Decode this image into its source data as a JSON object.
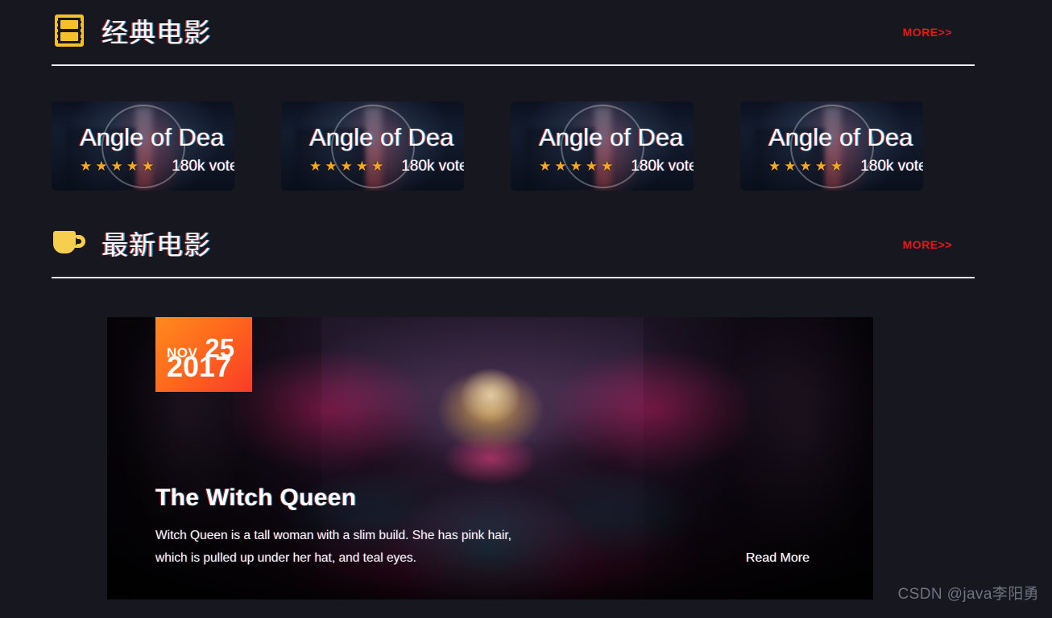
{
  "page": {
    "background": "#16171f",
    "accent_red": "#f21414",
    "accent_gold": "#f4c02c"
  },
  "sections": [
    {
      "id": "classic-movies",
      "icon": "film-strip-icon",
      "title": "经典电影",
      "more_label": "MORE>>"
    },
    {
      "id": "latest-movies",
      "icon": "cup-icon",
      "title": "最新电影",
      "more_label": "MORE>>"
    }
  ],
  "movie_cards": [
    {
      "title": "Angle of Dea",
      "stars": "★★★★★",
      "votes": "180k vote"
    },
    {
      "title": "Angle of Dea",
      "stars": "★★★★★",
      "votes": "180k vote"
    },
    {
      "title": "Angle of Dea",
      "stars": "★★★★★",
      "votes": "180k vote"
    },
    {
      "title": "Angle of Dea",
      "stars": "★★★★★",
      "votes": "180k vote"
    }
  ],
  "feature": {
    "date": {
      "month": "NOV",
      "day": "25",
      "year": "2017"
    },
    "title": "The Witch Queen",
    "description": "Witch Queen is a tall woman with a slim build. She has pink hair, which is pulled up under her hat, and teal eyes.",
    "read_more_label": "Read More"
  },
  "watermark": "CSDN @java李阳勇"
}
